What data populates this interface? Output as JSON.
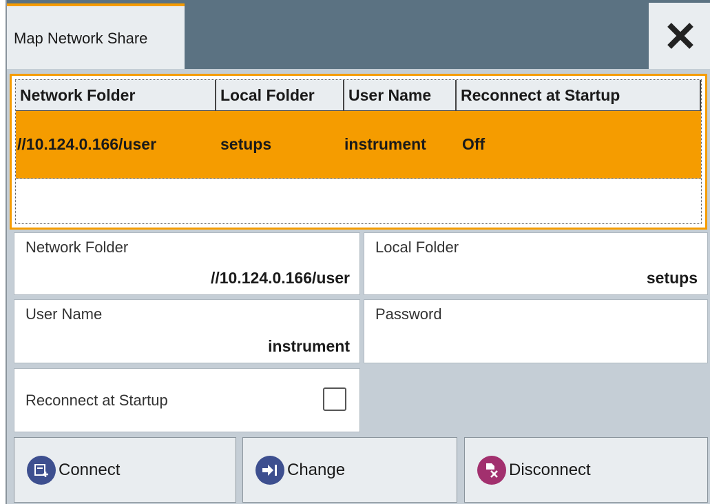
{
  "dialog": {
    "title": "Map Network Share",
    "close_icon": "close-icon"
  },
  "table": {
    "columns": [
      "Network Folder",
      "Local Folder",
      "User Name",
      "Reconnect at Startup"
    ],
    "rows": [
      {
        "network_folder": "//10.124.0.166/user",
        "local_folder": "setups",
        "user_name": "instrument",
        "reconnect": "Off",
        "selected": true
      }
    ]
  },
  "form": {
    "network_folder": {
      "label": "Network Folder",
      "value": "//10.124.0.166/user"
    },
    "local_folder": {
      "label": "Local Folder",
      "value": "setups"
    },
    "user_name": {
      "label": "User Name",
      "value": "instrument"
    },
    "password": {
      "label": "Password",
      "value": ""
    },
    "reconnect": {
      "label": "Reconnect at Startup",
      "checked": false
    }
  },
  "buttons": {
    "connect": {
      "label": "Connect",
      "icon": "connect-icon"
    },
    "change": {
      "label": "Change",
      "icon": "change-icon"
    },
    "disconnect": {
      "label": "Disconnect",
      "icon": "disconnect-icon"
    }
  },
  "colors": {
    "accent": "#f59c00",
    "titlebar": "#5b7282",
    "panel": "#c5ced6",
    "button_icon_blue": "#3d4f8f",
    "button_icon_magenta": "#a2306e"
  }
}
